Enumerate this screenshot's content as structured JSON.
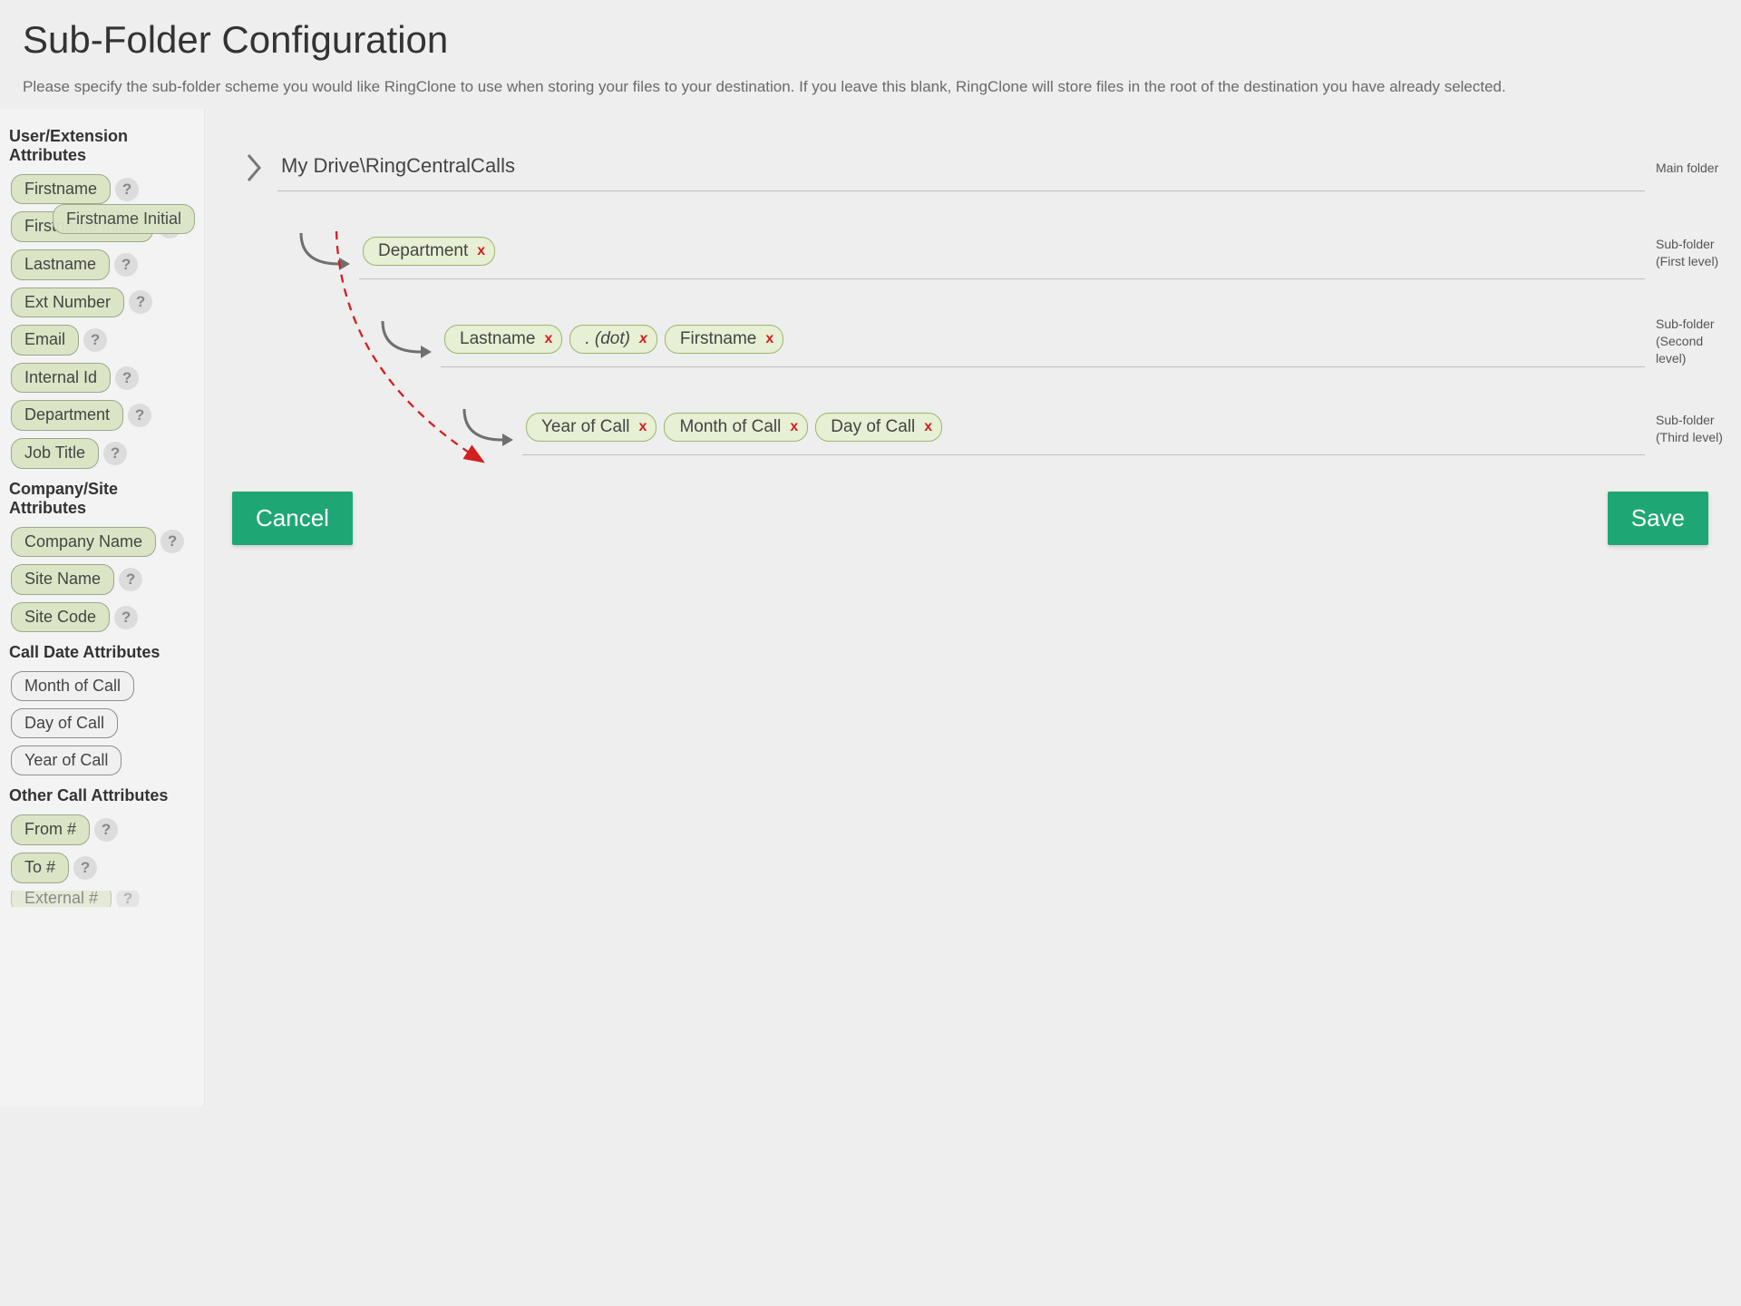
{
  "header": {
    "title": "Sub-Folder Configuration",
    "description": "Please specify the sub-folder scheme you would like RingClone to use when storing your files to your destination. If you leave this blank, RingClone will store files in the root of the destination you have already selected."
  },
  "sidebar": {
    "sections": [
      {
        "heading": "User/Extension Attributes",
        "items": [
          {
            "label": "Firstname",
            "help": true
          },
          {
            "label": "Firstname Initial",
            "help": true
          },
          {
            "label": "Lastname",
            "help": true
          },
          {
            "label": "Ext Number",
            "help": true
          },
          {
            "label": "Email",
            "help": true
          },
          {
            "label": "Internal Id",
            "help": true
          },
          {
            "label": "Department",
            "help": true
          },
          {
            "label": "Job Title",
            "help": true
          }
        ]
      },
      {
        "heading": "Company/Site Attributes",
        "items": [
          {
            "label": "Company Name",
            "help": true
          },
          {
            "label": "Site Name",
            "help": true
          },
          {
            "label": "Site Code",
            "help": true
          }
        ]
      },
      {
        "heading": "Call Date Attributes",
        "items": [
          {
            "label": "Month of Call",
            "help": false
          },
          {
            "label": "Day of Call",
            "help": false
          },
          {
            "label": "Year of Call",
            "help": false
          }
        ]
      },
      {
        "heading": "Other Call Attributes",
        "items": [
          {
            "label": "From #",
            "help": true
          },
          {
            "label": "To #",
            "help": true
          },
          {
            "label": "External #",
            "help": true
          }
        ]
      }
    ]
  },
  "folders": {
    "main": {
      "path": "My Drive\\RingCentralCalls",
      "label": "Main folder"
    },
    "levels": [
      {
        "label": "Sub-folder (First level)",
        "items": [
          {
            "text": "Department"
          }
        ]
      },
      {
        "label": "Sub-folder (Second level)",
        "items": [
          {
            "text": "Lastname"
          },
          {
            "text": ". (dot)",
            "italic": true
          },
          {
            "text": "Firstname"
          }
        ]
      },
      {
        "label": "Sub-folder (Third level)",
        "items": [
          {
            "text": "Year of Call"
          },
          {
            "text": "Month of Call"
          },
          {
            "text": "Day of Call"
          }
        ]
      }
    ]
  },
  "drag": {
    "ghost_label": "Firstname Initial"
  },
  "buttons": {
    "cancel": "Cancel",
    "save": "Save"
  }
}
